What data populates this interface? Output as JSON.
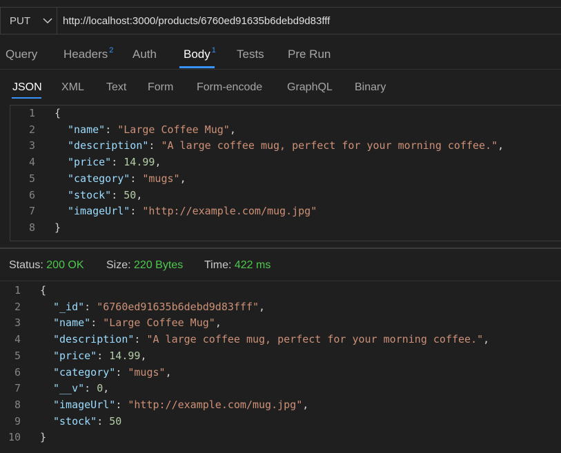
{
  "request": {
    "method": "PUT",
    "url": "http://localhost:3000/products/6760ed91635b6debd9d83fff"
  },
  "tabs": [
    {
      "label": "Query",
      "badge": ""
    },
    {
      "label": "Headers",
      "badge": "2"
    },
    {
      "label": "Auth",
      "badge": ""
    },
    {
      "label": "Body",
      "badge": "1"
    },
    {
      "label": "Tests",
      "badge": ""
    },
    {
      "label": "Pre Run",
      "badge": ""
    }
  ],
  "active_tab": "Body",
  "body_tabs": [
    "JSON",
    "XML",
    "Text",
    "Form",
    "Form-encode",
    "GraphQL",
    "Binary"
  ],
  "active_body_tab": "JSON",
  "request_body": [
    {
      "n": "1",
      "indent": 0,
      "parts": [
        [
          "p",
          "{"
        ]
      ]
    },
    {
      "n": "2",
      "indent": 1,
      "parts": [
        [
          "k",
          "\"name\""
        ],
        [
          "p",
          ": "
        ],
        [
          "s",
          "\"Large Coffee Mug\""
        ],
        [
          "p",
          ","
        ]
      ]
    },
    {
      "n": "3",
      "indent": 1,
      "parts": [
        [
          "k",
          "\"description\""
        ],
        [
          "p",
          ": "
        ],
        [
          "s",
          "\"A large coffee mug, perfect for your morning coffee.\""
        ],
        [
          "p",
          ","
        ]
      ]
    },
    {
      "n": "4",
      "indent": 1,
      "parts": [
        [
          "k",
          "\"price\""
        ],
        [
          "p",
          ": "
        ],
        [
          "n",
          "14.99"
        ],
        [
          "p",
          ","
        ]
      ]
    },
    {
      "n": "5",
      "indent": 1,
      "parts": [
        [
          "k",
          "\"category\""
        ],
        [
          "p",
          ": "
        ],
        [
          "s",
          "\"mugs\""
        ],
        [
          "p",
          ","
        ]
      ]
    },
    {
      "n": "6",
      "indent": 1,
      "parts": [
        [
          "k",
          "\"stock\""
        ],
        [
          "p",
          ": "
        ],
        [
          "n",
          "50"
        ],
        [
          "p",
          ","
        ]
      ]
    },
    {
      "n": "7",
      "indent": 1,
      "parts": [
        [
          "k",
          "\"imageUrl\""
        ],
        [
          "p",
          ": "
        ],
        [
          "s",
          "\"http://example.com/mug.jpg\""
        ]
      ]
    },
    {
      "n": "8",
      "indent": 0,
      "parts": [
        [
          "p",
          "}"
        ]
      ]
    }
  ],
  "status": {
    "status_label": "Status:",
    "status_value": "200 OK",
    "size_label": "Size:",
    "size_value": "220 Bytes",
    "time_label": "Time:",
    "time_value": "422 ms"
  },
  "response_body": [
    {
      "n": "1",
      "indent": 0,
      "parts": [
        [
          "p",
          "{"
        ]
      ]
    },
    {
      "n": "2",
      "indent": 1,
      "parts": [
        [
          "k",
          "\"_id\""
        ],
        [
          "p",
          ": "
        ],
        [
          "s",
          "\"6760ed91635b6debd9d83fff\""
        ],
        [
          "p",
          ","
        ]
      ]
    },
    {
      "n": "3",
      "indent": 1,
      "parts": [
        [
          "k",
          "\"name\""
        ],
        [
          "p",
          ": "
        ],
        [
          "s",
          "\"Large Coffee Mug\""
        ],
        [
          "p",
          ","
        ]
      ]
    },
    {
      "n": "4",
      "indent": 1,
      "parts": [
        [
          "k",
          "\"description\""
        ],
        [
          "p",
          ": "
        ],
        [
          "s",
          "\"A large coffee mug, perfect for your morning coffee.\""
        ],
        [
          "p",
          ","
        ]
      ]
    },
    {
      "n": "5",
      "indent": 1,
      "parts": [
        [
          "k",
          "\"price\""
        ],
        [
          "p",
          ": "
        ],
        [
          "n",
          "14.99"
        ],
        [
          "p",
          ","
        ]
      ]
    },
    {
      "n": "6",
      "indent": 1,
      "parts": [
        [
          "k",
          "\"category\""
        ],
        [
          "p",
          ": "
        ],
        [
          "s",
          "\"mugs\""
        ],
        [
          "p",
          ","
        ]
      ]
    },
    {
      "n": "7",
      "indent": 1,
      "parts": [
        [
          "k",
          "\"__v\""
        ],
        [
          "p",
          ": "
        ],
        [
          "n",
          "0"
        ],
        [
          "p",
          ","
        ]
      ]
    },
    {
      "n": "8",
      "indent": 1,
      "parts": [
        [
          "k",
          "\"imageUrl\""
        ],
        [
          "p",
          ": "
        ],
        [
          "s",
          "\"http://example.com/mug.jpg\""
        ],
        [
          "p",
          ","
        ]
      ]
    },
    {
      "n": "9",
      "indent": 1,
      "parts": [
        [
          "k",
          "\"stock\""
        ],
        [
          "p",
          ": "
        ],
        [
          "n",
          "50"
        ]
      ]
    },
    {
      "n": "10",
      "indent": 0,
      "parts": [
        [
          "p",
          "}"
        ]
      ]
    }
  ]
}
